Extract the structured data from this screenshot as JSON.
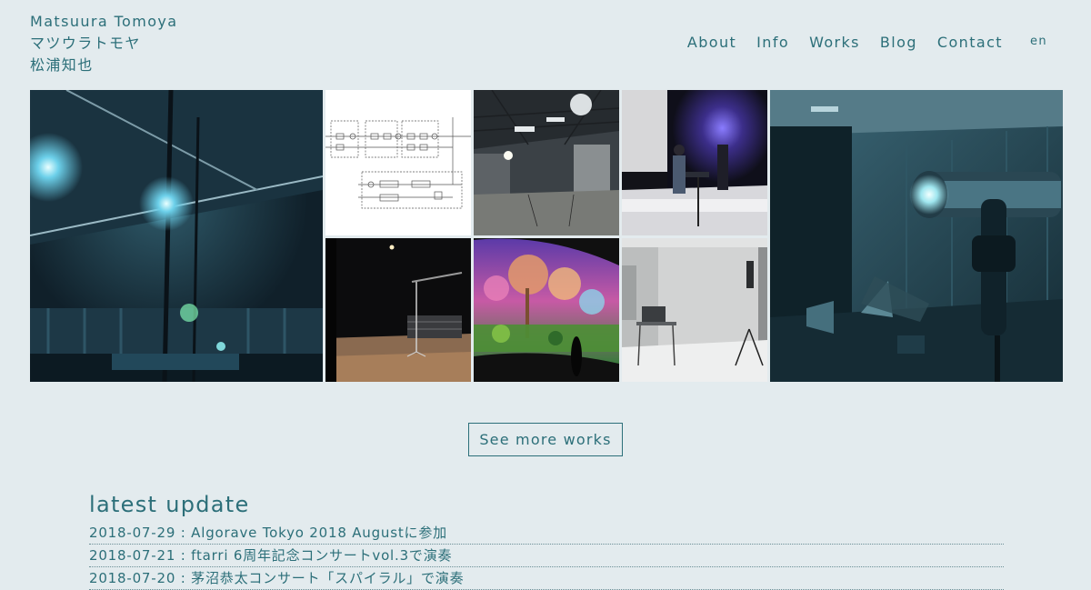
{
  "site": {
    "name_en": "Matsuura Tomoya",
    "name_kana": "マツウラトモヤ",
    "name_kanji": "松浦知也"
  },
  "nav": {
    "items": [
      {
        "label": "About"
      },
      {
        "label": "Info"
      },
      {
        "label": "Works"
      },
      {
        "label": "Blog"
      },
      {
        "label": "Contact"
      }
    ],
    "lang": "en"
  },
  "gallery": {
    "tiles": [
      {
        "subject": "dark hall with microphone stand and blue stage lights"
      },
      {
        "subject": "signal flow block diagram"
      },
      {
        "subject": "warehouse space with hanging loudspeakers"
      },
      {
        "subject": "performer at laptop on stage with purple light"
      },
      {
        "subject": "close-up of microphone in dark room"
      },
      {
        "subject": "black stage with boom microphone and risers"
      },
      {
        "subject": "curved panoramic projection of colorful forest"
      },
      {
        "subject": "white room with laptop on stand"
      }
    ]
  },
  "more_button": {
    "label": "See more works"
  },
  "updates": {
    "title": "latest update",
    "items": [
      {
        "text": "2018-07-29 : Algorave Tokyo 2018 Augustに参加"
      },
      {
        "text": "2018-07-21 : ftarri 6周年記念コンサートvol.3で演奏"
      },
      {
        "text": "2018-07-20 : 茅沼恭太コンサート「スパイラル」で演奏"
      }
    ]
  },
  "colors": {
    "background": "#e3ebee",
    "accent": "#2c6f79"
  }
}
